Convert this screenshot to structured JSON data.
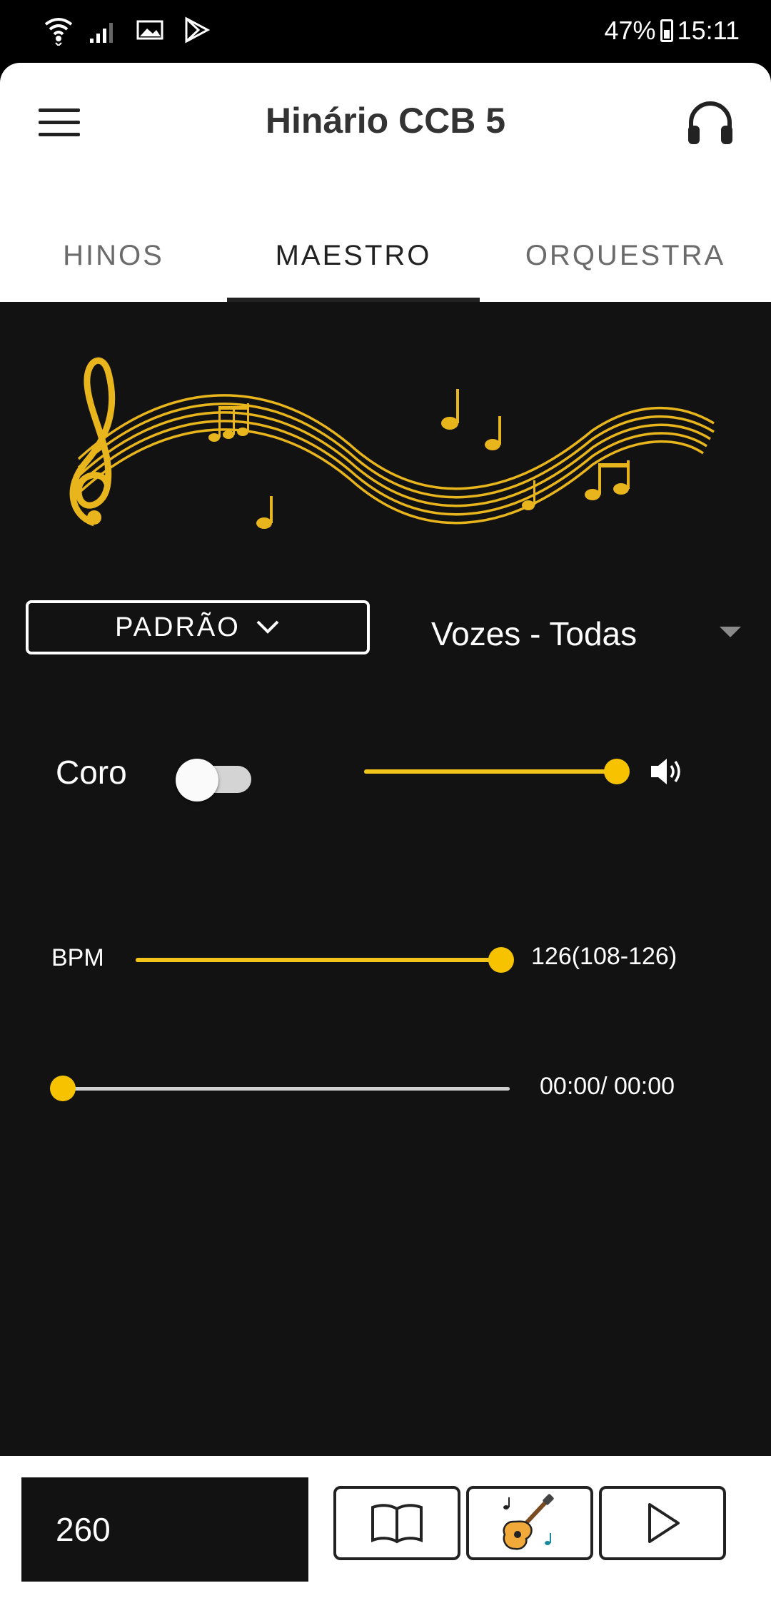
{
  "status_bar": {
    "battery": "47%",
    "time": "15:11",
    "icons": [
      "wifi-icon",
      "signal-icon",
      "gallery-icon",
      "play-store-icon",
      "battery-icon"
    ]
  },
  "app_bar": {
    "title": "Hinário CCB 5",
    "menu_icon": "menu-icon",
    "action_icon": "headphones-icon"
  },
  "tabs": [
    {
      "label": "HINOS",
      "active": false
    },
    {
      "label": "MAESTRO",
      "active": true
    },
    {
      "label": "ORQUESTRA",
      "active": false
    }
  ],
  "controls": {
    "preset_button": "PADRÃO",
    "voices_select": "Vozes - Todas",
    "choir_label": "Coro",
    "choir_on": false,
    "volume_level": 1.0,
    "bpm_label": "BPM",
    "bpm_value": "126(108-126)",
    "bpm_current": 126,
    "bpm_min": 108,
    "bpm_max": 126,
    "time_text": "00:00/ 00:00",
    "progress": 0.0
  },
  "bottom_bar": {
    "hymn_number": "260",
    "buttons": [
      "book-icon",
      "guitar-icon",
      "play-icon"
    ]
  },
  "colors": {
    "accent": "#f7c300",
    "background": "#121212",
    "banner_gold": "#e9b51c"
  }
}
